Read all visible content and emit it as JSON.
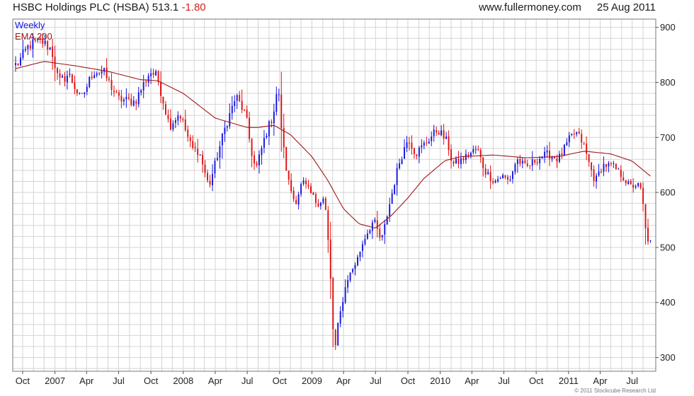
{
  "header": {
    "title": "HSBC Holdings PLC (HSBA)",
    "price": "513.1",
    "change": "-1.80",
    "website": "www.fullermoney.com",
    "date": "25 Aug 2011"
  },
  "footer": {
    "copyright": "© 2011 Stockcube Research Ltd"
  },
  "colors": {
    "up": "#1414e0",
    "down": "#e01010",
    "ema": "#a01818",
    "grid": "#d4d4d4"
  },
  "chart_data": {
    "type": "candlestick",
    "legend": [
      {
        "label": "Weekly",
        "color": "#1414e0"
      },
      {
        "label": "EMA 200",
        "color": "#a01818"
      }
    ],
    "grid": true,
    "legend_position": "top-left",
    "y_axis": {
      "side": "right",
      "ylim": [
        275,
        915
      ],
      "ticks": [
        300,
        400,
        500,
        600,
        700,
        800,
        900
      ]
    },
    "x_axis": {
      "labels": [
        "Oct",
        "2007",
        "Apr",
        "Jul",
        "Oct",
        "2008",
        "Apr",
        "Jul",
        "Oct",
        "2009",
        "Apr",
        "Jul",
        "Oct",
        "2010",
        "Apr",
        "Jul",
        "Oct",
        "2011",
        "Apr",
        "Jul"
      ],
      "range": [
        "2006-09-11",
        "2011-08-25"
      ]
    },
    "price_anchors": [
      [
        "2006-09-15",
        832
      ],
      [
        "2006-10-20",
        868
      ],
      [
        "2006-11-24",
        875
      ],
      [
        "2006-12-22",
        860
      ],
      [
        "2007-01-12",
        800
      ],
      [
        "2007-02-09",
        815
      ],
      [
        "2007-03-16",
        768
      ],
      [
        "2007-04-20",
        820
      ],
      [
        "2007-05-18",
        820
      ],
      [
        "2007-06-29",
        770
      ],
      [
        "2007-08-17",
        765
      ],
      [
        "2007-09-28",
        820
      ],
      [
        "2007-10-19",
        810
      ],
      [
        "2007-11-23",
        720
      ],
      [
        "2007-12-21",
        745
      ],
      [
        "2008-01-25",
        680
      ],
      [
        "2008-02-15",
        675
      ],
      [
        "2008-03-14",
        610
      ],
      [
        "2008-04-25",
        710
      ],
      [
        "2008-05-30",
        775
      ],
      [
        "2008-06-27",
        740
      ],
      [
        "2008-07-11",
        680
      ],
      [
        "2008-07-25",
        640
      ],
      [
        "2008-08-22",
        705
      ],
      [
        "2008-09-12",
        740
      ],
      [
        "2008-09-26",
        795
      ],
      [
        "2008-10-10",
        690
      ],
      [
        "2008-10-24",
        625
      ],
      [
        "2008-11-14",
        580
      ],
      [
        "2008-12-05",
        620
      ],
      [
        "2008-12-26",
        600
      ],
      [
        "2009-01-16",
        580
      ],
      [
        "2009-02-06",
        590
      ],
      [
        "2009-02-20",
        480
      ],
      [
        "2009-03-06",
        300
      ],
      [
        "2009-03-13",
        350
      ],
      [
        "2009-04-10",
        440
      ],
      [
        "2009-05-08",
        475
      ],
      [
        "2009-05-29",
        515
      ],
      [
        "2009-06-26",
        550
      ],
      [
        "2009-07-17",
        510
      ],
      [
        "2009-08-07",
        570
      ],
      [
        "2009-09-04",
        650
      ],
      [
        "2009-10-02",
        700
      ],
      [
        "2009-10-23",
        670
      ],
      [
        "2009-12-04",
        700
      ],
      [
        "2009-12-25",
        715
      ],
      [
        "2010-01-22",
        690
      ],
      [
        "2010-02-05",
        650
      ],
      [
        "2010-03-05",
        660
      ],
      [
        "2010-04-16",
        680
      ],
      [
        "2010-05-07",
        640
      ],
      [
        "2010-06-04",
        620
      ],
      [
        "2010-06-25",
        630
      ],
      [
        "2010-07-16",
        620
      ],
      [
        "2010-08-06",
        660
      ],
      [
        "2010-09-03",
        645
      ],
      [
        "2010-10-01",
        660
      ],
      [
        "2010-11-05",
        670
      ],
      [
        "2010-12-03",
        660
      ],
      [
        "2011-01-07",
        700
      ],
      [
        "2011-01-21",
        710
      ],
      [
        "2011-02-11",
        690
      ],
      [
        "2011-03-04",
        645
      ],
      [
        "2011-03-18",
        620
      ],
      [
        "2011-04-08",
        650
      ],
      [
        "2011-05-06",
        648
      ],
      [
        "2011-06-03",
        630
      ],
      [
        "2011-06-24",
        610
      ],
      [
        "2011-07-15",
        615
      ],
      [
        "2011-07-29",
        600
      ],
      [
        "2011-08-05",
        545
      ],
      [
        "2011-08-12",
        515
      ],
      [
        "2011-08-25",
        513
      ]
    ],
    "ema200": [
      [
        "2006-09-11",
        825
      ],
      [
        "2006-12-01",
        838
      ],
      [
        "2007-03-01",
        830
      ],
      [
        "2007-06-01",
        820
      ],
      [
        "2007-09-01",
        805
      ],
      [
        "2007-10-20",
        803
      ],
      [
        "2008-01-01",
        780
      ],
      [
        "2008-04-01",
        735
      ],
      [
        "2008-07-01",
        718
      ],
      [
        "2008-08-01",
        718
      ],
      [
        "2008-09-15",
        722
      ],
      [
        "2008-11-01",
        705
      ],
      [
        "2009-01-01",
        665
      ],
      [
        "2009-02-15",
        622
      ],
      [
        "2009-04-01",
        570
      ],
      [
        "2009-05-15",
        543
      ],
      [
        "2009-07-01",
        535
      ],
      [
        "2009-08-15",
        558
      ],
      [
        "2009-10-01",
        590
      ],
      [
        "2009-11-15",
        625
      ],
      [
        "2010-01-15",
        658
      ],
      [
        "2010-03-01",
        665
      ],
      [
        "2010-06-01",
        668
      ],
      [
        "2010-09-01",
        663
      ],
      [
        "2010-12-01",
        665
      ],
      [
        "2011-02-15",
        675
      ],
      [
        "2011-05-01",
        670
      ],
      [
        "2011-07-01",
        657
      ],
      [
        "2011-08-25",
        628
      ]
    ]
  }
}
